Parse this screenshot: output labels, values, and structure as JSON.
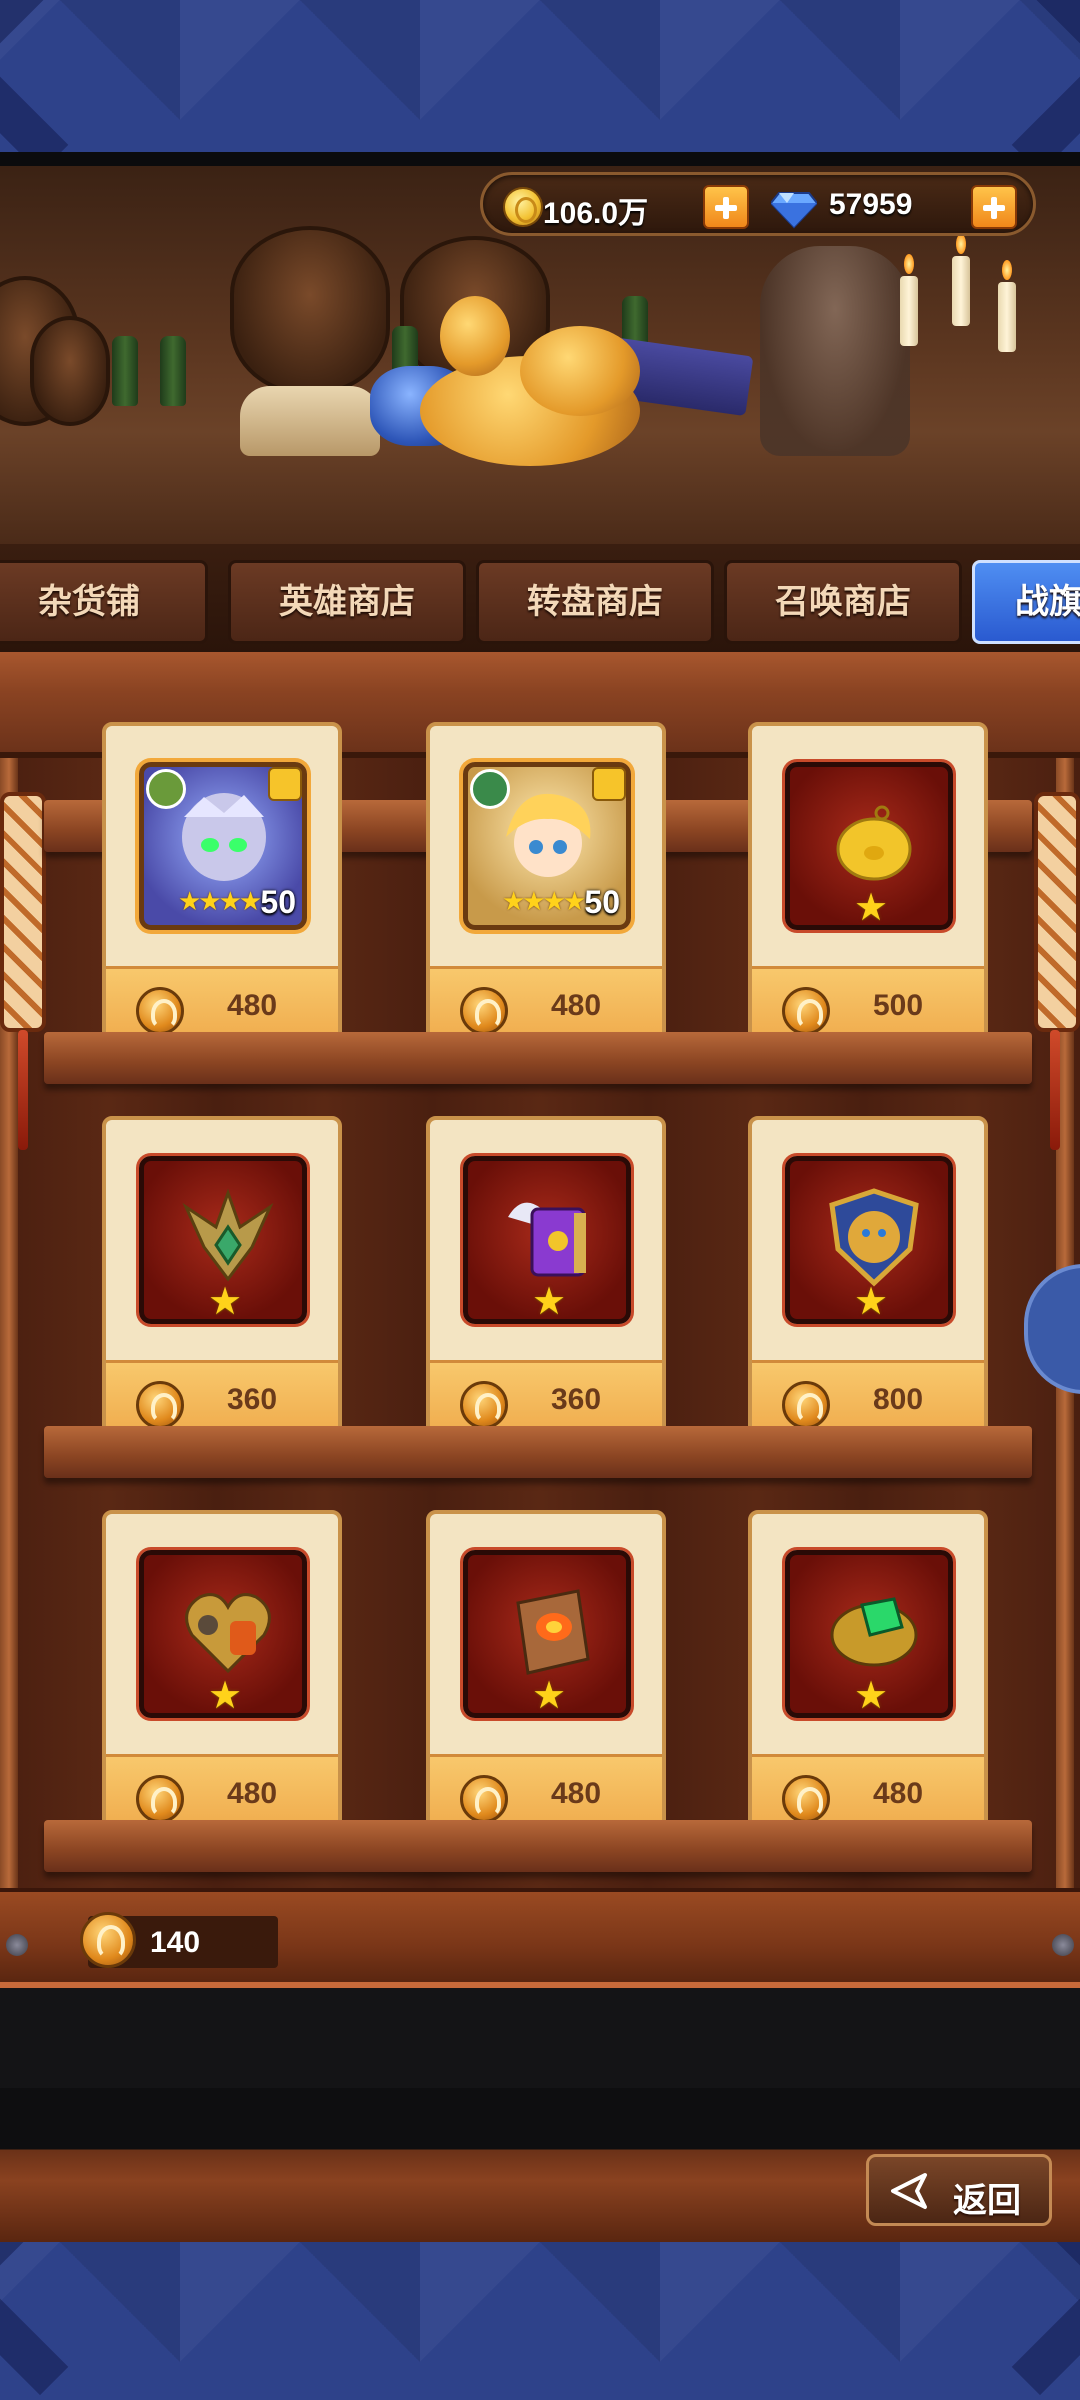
{
  "currency": {
    "gold": "106.0万",
    "diamonds": "57959",
    "gold_icon": "gold-coin-icon",
    "diamond_icon": "diamond-icon",
    "plus_icon": "plus-icon"
  },
  "tabs": [
    {
      "label": "杂货铺",
      "active": false
    },
    {
      "label": "英雄商店",
      "active": false
    },
    {
      "label": "转盘商店",
      "active": false
    },
    {
      "label": "召唤商店",
      "active": false
    },
    {
      "label": "战旗",
      "active": true
    }
  ],
  "items": [
    {
      "name": "hero-shard-dark-elf",
      "icon": "dark-elf-hero-icon",
      "level": "50",
      "stars": 4,
      "price": "480"
    },
    {
      "name": "hero-shard-blonde-elf",
      "icon": "blonde-elf-hero-icon",
      "level": "50",
      "stars": 4,
      "price": "480"
    },
    {
      "name": "golden-piggy",
      "icon": "golden-pig-icon",
      "stars": 1,
      "price": "500"
    },
    {
      "name": "jade-spiked-artifact",
      "icon": "spiked-artifact-icon",
      "stars": 1,
      "price": "360"
    },
    {
      "name": "winged-purple-tome",
      "icon": "winged-tome-icon",
      "stars": 1,
      "price": "360"
    },
    {
      "name": "lion-shield",
      "icon": "lion-shield-icon",
      "stars": 1,
      "price": "800"
    },
    {
      "name": "mechanical-heart",
      "icon": "mechanical-heart-icon",
      "stars": 1,
      "price": "480"
    },
    {
      "name": "fire-spell-book",
      "icon": "fire-book-icon",
      "stars": 1,
      "price": "480"
    },
    {
      "name": "emerald-bracer",
      "icon": "emerald-bracer-icon",
      "stars": 1,
      "price": "480"
    }
  ],
  "balance": {
    "value": "140",
    "icon": "banner-coin-icon"
  },
  "back_button": {
    "label": "返回",
    "icon": "back-arrow-icon"
  },
  "colors": {
    "active_tab": "#2a5ad0",
    "price_bar": "#f8c86c",
    "frame_blue": "#2e428a"
  }
}
